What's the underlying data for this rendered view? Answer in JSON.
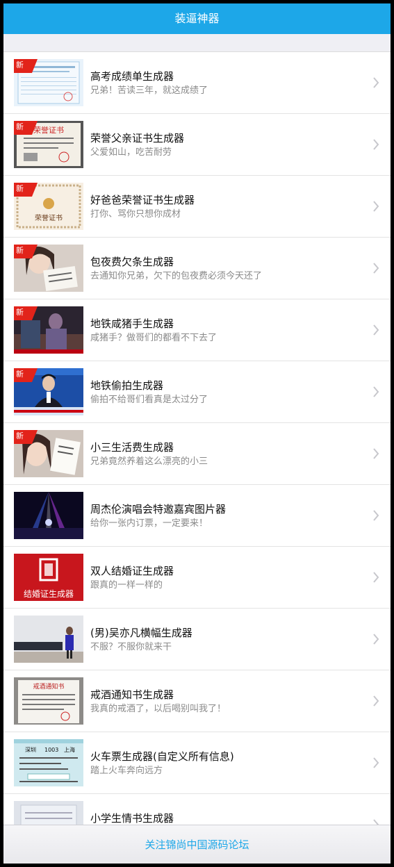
{
  "header": {
    "title": "装逼神器"
  },
  "badge_label": "新",
  "items": [
    {
      "title": "高考成绩单生成器",
      "subtitle": "兄弟！苦读三年，就这成绩了",
      "new": true,
      "thumb": "certificate-blue"
    },
    {
      "title": "荣誉父亲证书生成器",
      "subtitle": "父爱如山，吃苦耐劳",
      "new": true,
      "thumb": "honor-certificate"
    },
    {
      "title": "好爸爸荣誉证书生成器",
      "subtitle": "打你、骂你只想你成材",
      "new": true,
      "thumb": "honor-certificate-ornate"
    },
    {
      "title": "包夜费欠条生成器",
      "subtitle": "去通知你兄弟，欠下的包夜费必须今天还了",
      "new": true,
      "thumb": "photo-girl-note"
    },
    {
      "title": "地铁咸猪手生成器",
      "subtitle": "咸猪手？做哥们的都看不下去了",
      "new": true,
      "thumb": "photo-subway"
    },
    {
      "title": "地铁偷拍生成器",
      "subtitle": "偷拍不给哥们看真是太过分了",
      "new": true,
      "thumb": "photo-news-anchor"
    },
    {
      "title": "小三生活费生成器",
      "subtitle": "兄弟竟然养着这么漂亮的小三",
      "new": true,
      "thumb": "photo-girl-card"
    },
    {
      "title": "周杰伦演唱会特邀嘉宾图片器",
      "subtitle": "给你一张内订票，一定要来！",
      "new": false,
      "thumb": "photo-concert"
    },
    {
      "title": "双人结婚证生成器",
      "subtitle": "跟真的一样一样的",
      "new": false,
      "thumb": "marriage-certificate"
    },
    {
      "title": "(男)吴亦凡横幅生成器",
      "subtitle": "不服？不服你就来干",
      "new": false,
      "thumb": "photo-banner"
    },
    {
      "title": "戒酒通知书生成器",
      "subtitle": "我真的戒酒了，以后喝别叫我了！",
      "new": false,
      "thumb": "notice-letter"
    },
    {
      "title": "火车票生成器(自定义所有信息)",
      "subtitle": "踏上火车奔向远方",
      "new": false,
      "thumb": "train-ticket"
    },
    {
      "title": "小学生情书生成器",
      "subtitle": "",
      "new": false,
      "thumb": "letter-paper"
    }
  ],
  "footer": {
    "link_label": "关注锦尚中国源码论坛"
  },
  "thumb_texts": {
    "marriage": "结婚证生成器",
    "honor": "荣誉证书",
    "honor_cert": "荣誉证书",
    "ticket_from": "深圳",
    "ticket_no": "1003",
    "ticket_to": "上海",
    "notice_title": "戒酒通知书"
  }
}
